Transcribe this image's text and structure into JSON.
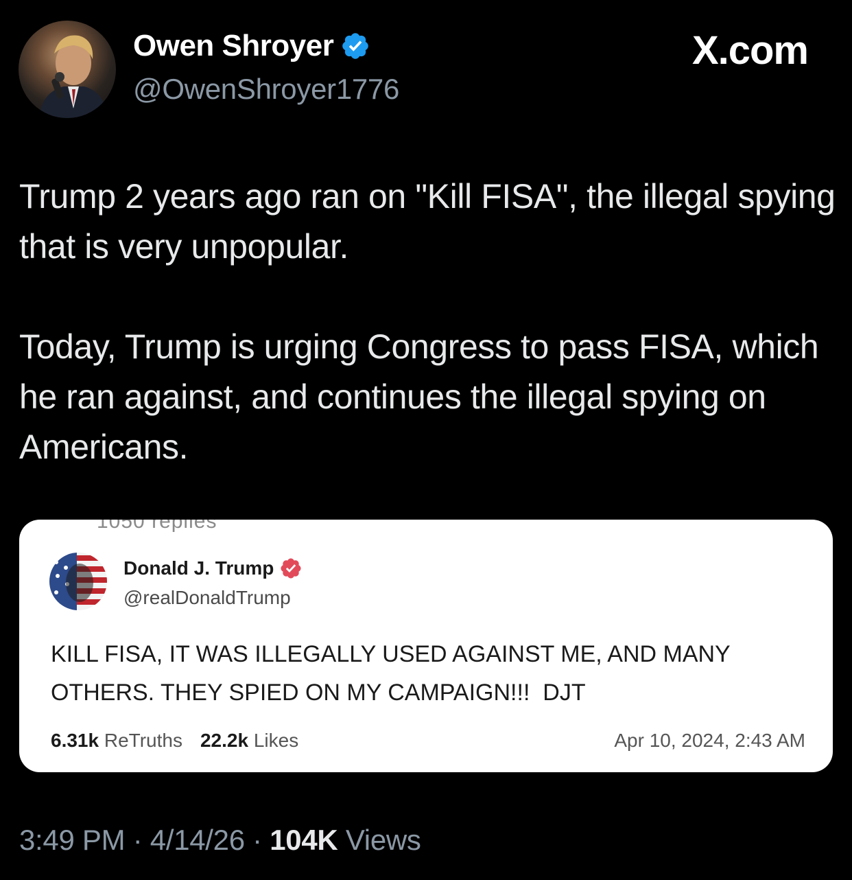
{
  "author": {
    "display_name": "Owen Shroyer",
    "handle": "@OwenShroyer1776",
    "avatar_icon": "profile-photo",
    "verified_icon": "verified-badge-icon",
    "verified_color": "#1d9bf0"
  },
  "watermark": "X.com",
  "tweet": {
    "paragraphs": [
      "Trump 2 years ago ran on \"Kill FISA\", the illegal spying that is very unpopular.",
      "Today, Trump is urging Congress to pass FISA, which he ran against, and continues the illegal spying on Americans."
    ]
  },
  "quoted_post": {
    "cutoff_text": "1050 replies",
    "display_name": "Donald J. Trump",
    "handle": "@realDonaldTrump",
    "verified_icon": "verified-badge-icon",
    "verified_color": "#e24a5a",
    "text": "KILL FISA, IT WAS ILLEGALLY USED AGAINST ME, AND MANY OTHERS. THEY SPIED ON MY CAMPAIGN!!!  DJT",
    "retruths_count": "6.31k",
    "retruths_label": "ReTruths",
    "likes_count": "22.2k",
    "likes_label": "Likes",
    "timestamp": "Apr 10, 2024, 2:43 AM"
  },
  "meta": {
    "time": "3:49 PM",
    "separator": " · ",
    "date": "4/14/26",
    "views_count": "104K",
    "views_label": "Views"
  }
}
